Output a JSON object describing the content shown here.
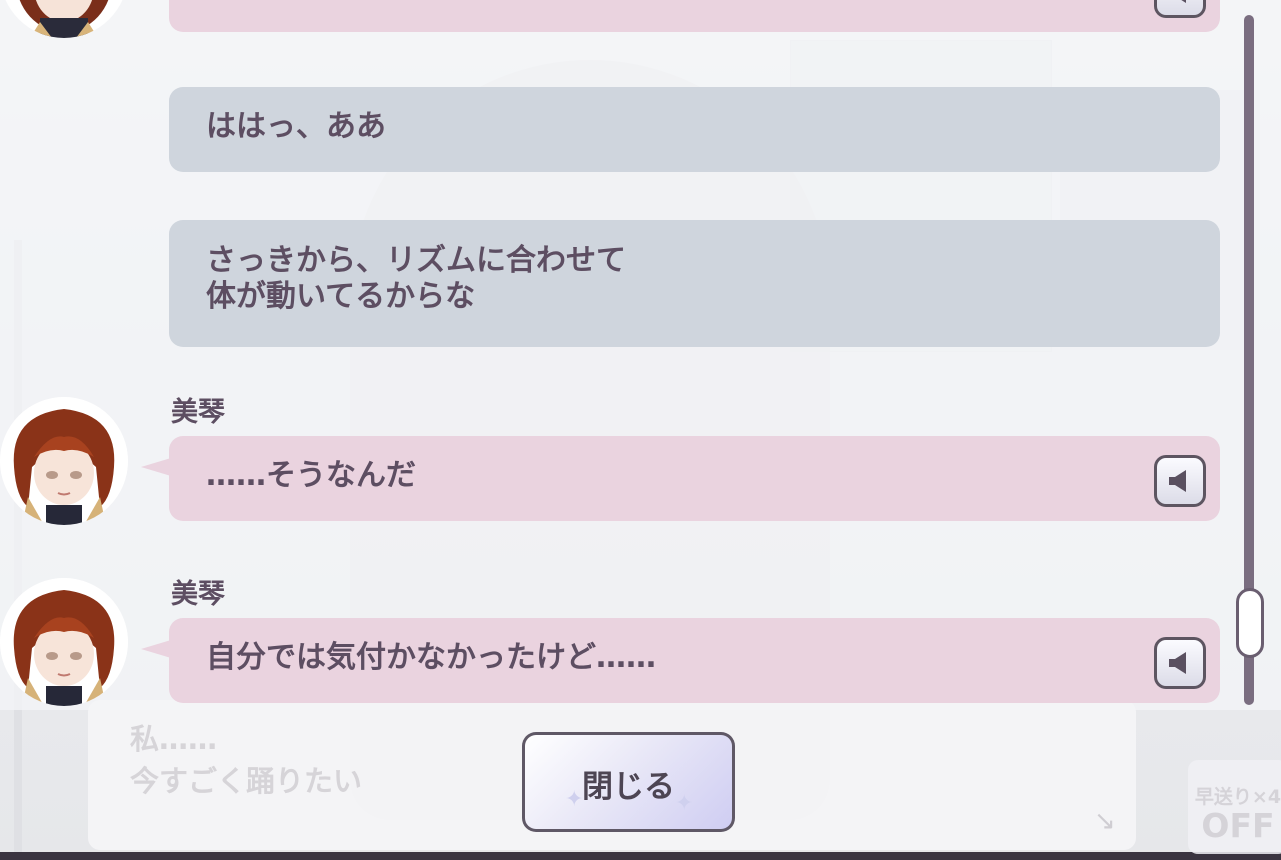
{
  "log": {
    "entries": [
      {
        "kind": "dialogue",
        "speaker": "",
        "lines": []
      },
      {
        "kind": "narration",
        "lines": [
          "ははっ、ああ"
        ]
      },
      {
        "kind": "narration",
        "lines": [
          "さっきから、リズムに合わせて",
          "体が動いてるからな"
        ]
      },
      {
        "kind": "dialogue",
        "speaker": "美琴",
        "lines": [
          "……そうなんだ"
        ],
        "voice_icon": "speaker-icon"
      },
      {
        "kind": "dialogue",
        "speaker": "美琴",
        "lines": [
          "自分では気付かなかったけど……"
        ],
        "voice_icon": "speaker-icon"
      }
    ]
  },
  "close_button": {
    "label": "閉じる"
  },
  "underlying_dialog": {
    "lines": [
      "私……",
      "今すごく踊りたい"
    ],
    "skip_label": "早送り×4",
    "skip_state": "OFF"
  },
  "colors": {
    "pink_bubble": "#ead3df",
    "gray_bubble": "#cfd5dd",
    "text": "#5d4e62",
    "scrollbar": "#7a6d80"
  },
  "scroll_position": 0.92
}
